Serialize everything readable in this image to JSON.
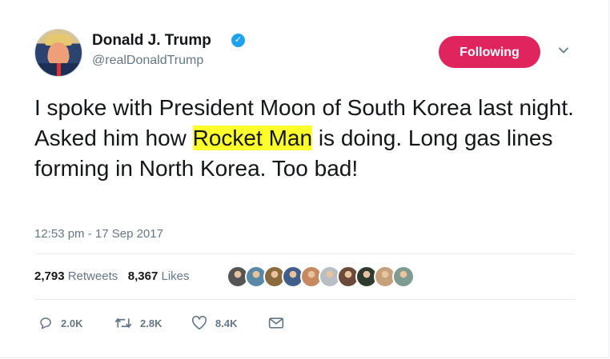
{
  "author": {
    "name": "Donald J. Trump",
    "handle": "@realDonaldTrump",
    "verified_icon": "verified-badge-icon"
  },
  "follow_button": {
    "label": "Following"
  },
  "tweet": {
    "text_before": "I spoke with President Moon of South Korea last night. Asked him how ",
    "highlight": "Rocket Man",
    "text_after": " is doing. Long gas lines forming in North Korea. Too bad!",
    "highlight_color": "#ffff2c",
    "timestamp": "12:53 pm - 17 Sep 2017"
  },
  "stats": {
    "retweets_count": "2,793",
    "retweets_label": "Retweets",
    "likes_count": "8,367",
    "likes_label": "Likes"
  },
  "likers": [
    {
      "icon": "liker-avatar",
      "color": "#555555"
    },
    {
      "icon": "liker-avatar",
      "color": "#5a8aa8"
    },
    {
      "icon": "liker-avatar",
      "color": "#8b6b3e"
    },
    {
      "icon": "liker-avatar",
      "color": "#3f5f8a"
    },
    {
      "icon": "liker-avatar",
      "color": "#c7895f"
    },
    {
      "icon": "liker-avatar",
      "color": "#b9bec4"
    },
    {
      "icon": "liker-avatar",
      "color": "#6b4a3a"
    },
    {
      "icon": "liker-avatar",
      "color": "#2f3b2f"
    },
    {
      "icon": "liker-avatar",
      "color": "#c5a07a"
    },
    {
      "icon": "liker-avatar",
      "color": "#7f9a8e"
    }
  ],
  "actions": {
    "reply": "2.0K",
    "retweet": "2.8K",
    "like": "8.4K"
  },
  "colors": {
    "follow": "#e0245e",
    "verified": "#1da1f2",
    "secondary_text": "#657786"
  }
}
